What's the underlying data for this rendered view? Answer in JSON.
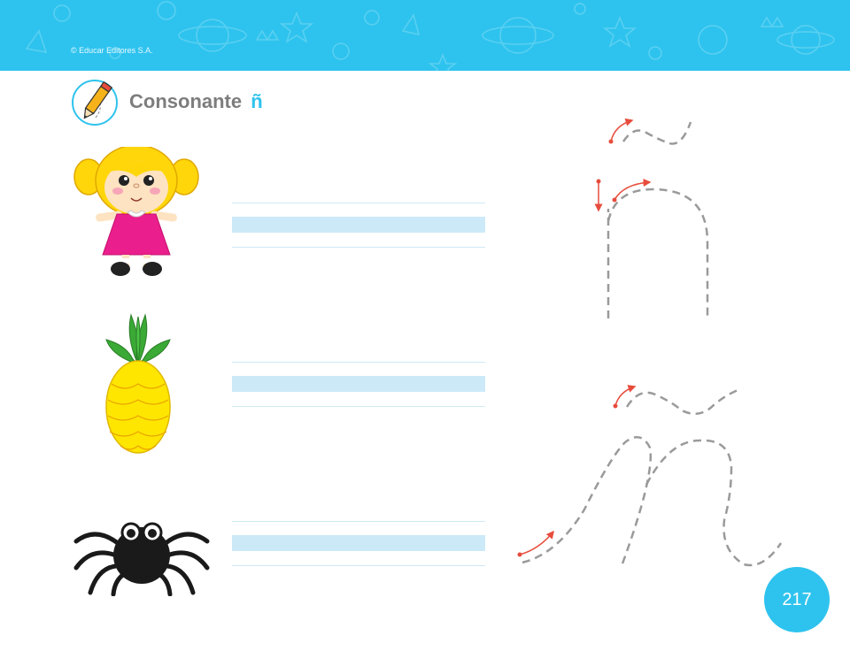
{
  "header": {
    "copyright": "© Educar Editores S.A.",
    "band_color": "#2ec3ee"
  },
  "title": {
    "prefix": "Consonante",
    "letter": "ñ",
    "icon": "pencil-writing-icon"
  },
  "exercises": [
    {
      "picture": "doll-illustration"
    },
    {
      "picture": "pineapple-illustration"
    },
    {
      "picture": "spider-illustration"
    }
  ],
  "tracing": {
    "print_letter": "ñ",
    "cursive_letter": "ñ",
    "guide_color": "#e74c3c",
    "dash_color": "#9a9a9a"
  },
  "footer": {
    "page_number": "217",
    "badge_color": "#2ec3ee"
  }
}
